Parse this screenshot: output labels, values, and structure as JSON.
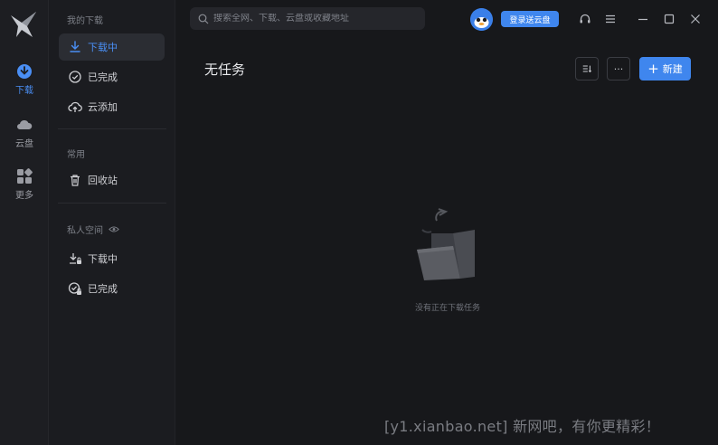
{
  "rail": {
    "items": [
      {
        "label": "下载",
        "icon": "download-circle-icon",
        "active": true
      },
      {
        "label": "云盘",
        "icon": "cloud-icon",
        "active": false
      },
      {
        "label": "更多",
        "icon": "grid-icon",
        "active": false
      }
    ]
  },
  "sidebar": {
    "section_my_downloads": "我的下载",
    "items": [
      {
        "label": "下载中",
        "icon": "download-icon",
        "active": true
      },
      {
        "label": "已完成",
        "icon": "check-circle-icon",
        "active": false
      },
      {
        "label": "云添加",
        "icon": "cloud-upload-icon",
        "active": false
      }
    ],
    "section_common": "常用",
    "common_items": [
      {
        "label": "回收站",
        "icon": "trash-icon"
      }
    ],
    "section_private": "私人空间",
    "private_items": [
      {
        "label": "下载中",
        "icon": "download-lock-icon"
      },
      {
        "label": "已完成",
        "icon": "check-lock-icon"
      }
    ]
  },
  "header": {
    "search_placeholder": "搜索全网、下载、云盘或收藏地址",
    "login_button": "登录送云盘"
  },
  "main": {
    "title": "无任务",
    "more_label": "···",
    "new_button": "新建",
    "empty_text": "没有正在下载任务"
  },
  "watermark": "[y1.xianbao.net] 新网吧，有你更精彩！",
  "colors": {
    "accent": "#3f86ee",
    "background": "#17181b",
    "sidebar": "#1b1c20"
  }
}
